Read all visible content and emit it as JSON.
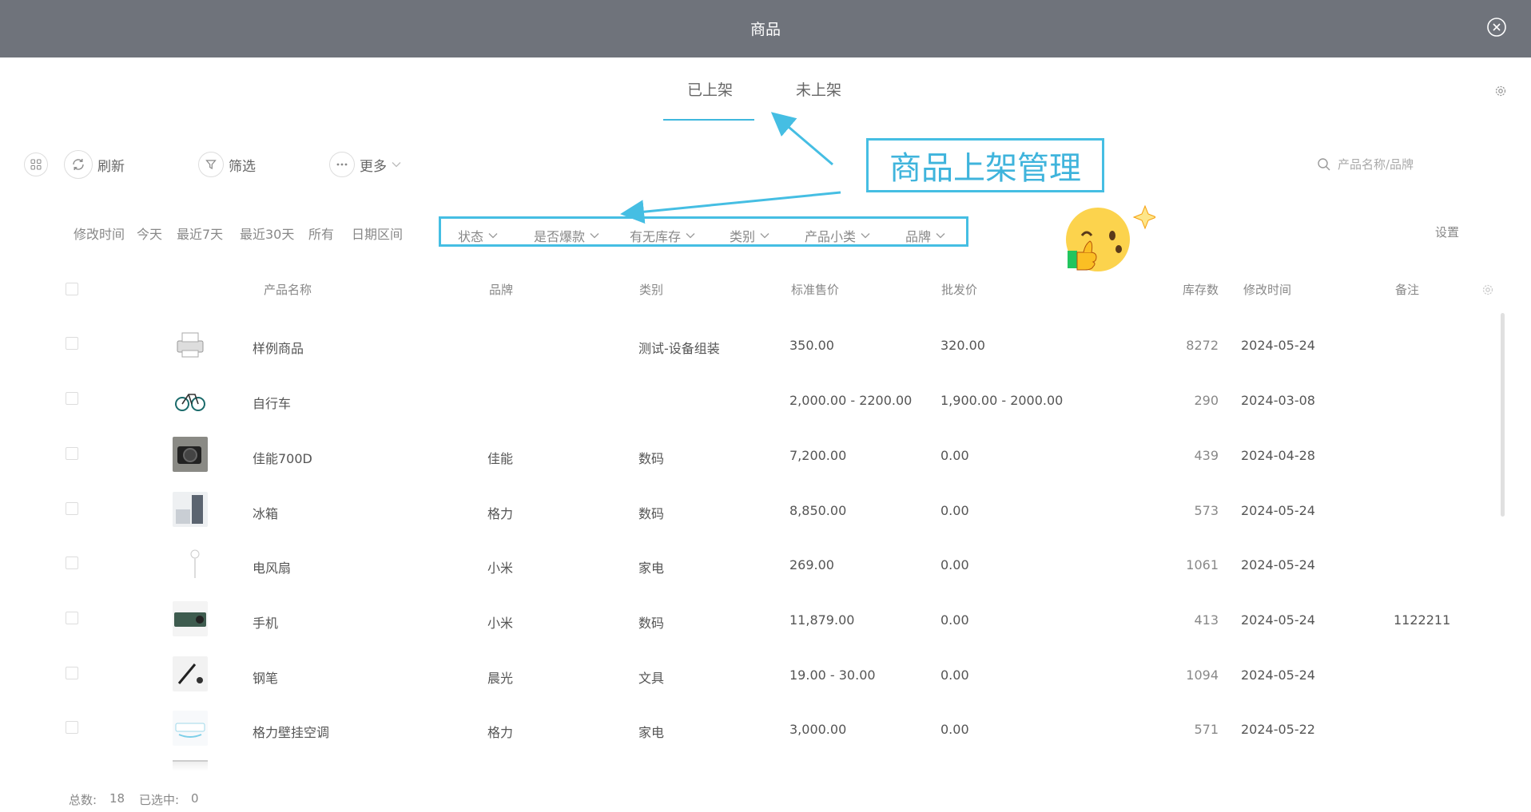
{
  "window": {
    "title": "商品"
  },
  "tabs": [
    {
      "label": "已上架",
      "active": true
    },
    {
      "label": "未上架",
      "active": false
    }
  ],
  "toolbar": {
    "refresh_label": "刷新",
    "filter_label": "筛选",
    "more_label": "更多"
  },
  "search": {
    "placeholder": "产品名称/品牌"
  },
  "date_filters": [
    "修改时间",
    "今天",
    "最近7天",
    "最近30天",
    "所有",
    "日期区间"
  ],
  "filter_dropdowns": [
    "状态",
    "是否爆款",
    "有无库存",
    "类别",
    "产品小类",
    "品牌"
  ],
  "settings_label": "设置",
  "annotation": {
    "text": "商品上架管理"
  },
  "colors": {
    "titlebar": "#6f737b",
    "accent": "#45bee3"
  },
  "table": {
    "columns": {
      "name": "产品名称",
      "brand": "品牌",
      "category": "类别",
      "std_price": "标准售价",
      "wholesale_price": "批发价",
      "stock": "库存数",
      "modified": "修改时间",
      "remark": "备注"
    },
    "rows": [
      {
        "name": "样例商品",
        "brand": "",
        "category": "测试-设备组装",
        "std_price": "350.00",
        "wholesale_price": "320.00",
        "stock": "8272",
        "modified": "2024-05-24",
        "remark": "",
        "thumb": "printer"
      },
      {
        "name": "自行车",
        "brand": "",
        "category": "",
        "std_price": "2,000.00 - 2200.00",
        "wholesale_price": "1,900.00 - 2000.00",
        "stock": "290",
        "modified": "2024-03-08",
        "remark": "",
        "thumb": "bicycle"
      },
      {
        "name": "佳能700D",
        "brand": "佳能",
        "category": "数码",
        "std_price": "7,200.00",
        "wholesale_price": "0.00",
        "stock": "439",
        "modified": "2024-04-28",
        "remark": "",
        "thumb": "camera"
      },
      {
        "name": "冰箱",
        "brand": "格力",
        "category": "数码",
        "std_price": "8,850.00",
        "wholesale_price": "0.00",
        "stock": "573",
        "modified": "2024-05-24",
        "remark": "",
        "thumb": "fridge"
      },
      {
        "name": "电风扇",
        "brand": "小米",
        "category": "家电",
        "std_price": "269.00",
        "wholesale_price": "0.00",
        "stock": "1061",
        "modified": "2024-05-24",
        "remark": "",
        "thumb": "fan"
      },
      {
        "name": "手机",
        "brand": "小米",
        "category": "数码",
        "std_price": "11,879.00",
        "wholesale_price": "0.00",
        "stock": "413",
        "modified": "2024-05-24",
        "remark": "1122211",
        "thumb": "phone"
      },
      {
        "name": "钢笔",
        "brand": "晨光",
        "category": "文具",
        "std_price": "19.00 - 30.00",
        "wholesale_price": "0.00",
        "stock": "1094",
        "modified": "2024-05-24",
        "remark": "",
        "thumb": "pen"
      },
      {
        "name": "格力壁挂空调",
        "brand": "格力",
        "category": "家电",
        "std_price": "3,000.00",
        "wholesale_price": "0.00",
        "stock": "571",
        "modified": "2024-05-22",
        "remark": "",
        "thumb": "aircon"
      }
    ]
  },
  "footer": {
    "total_label": "总数:",
    "total_value": "18",
    "selected_label": "已选中:",
    "selected_value": "0"
  }
}
